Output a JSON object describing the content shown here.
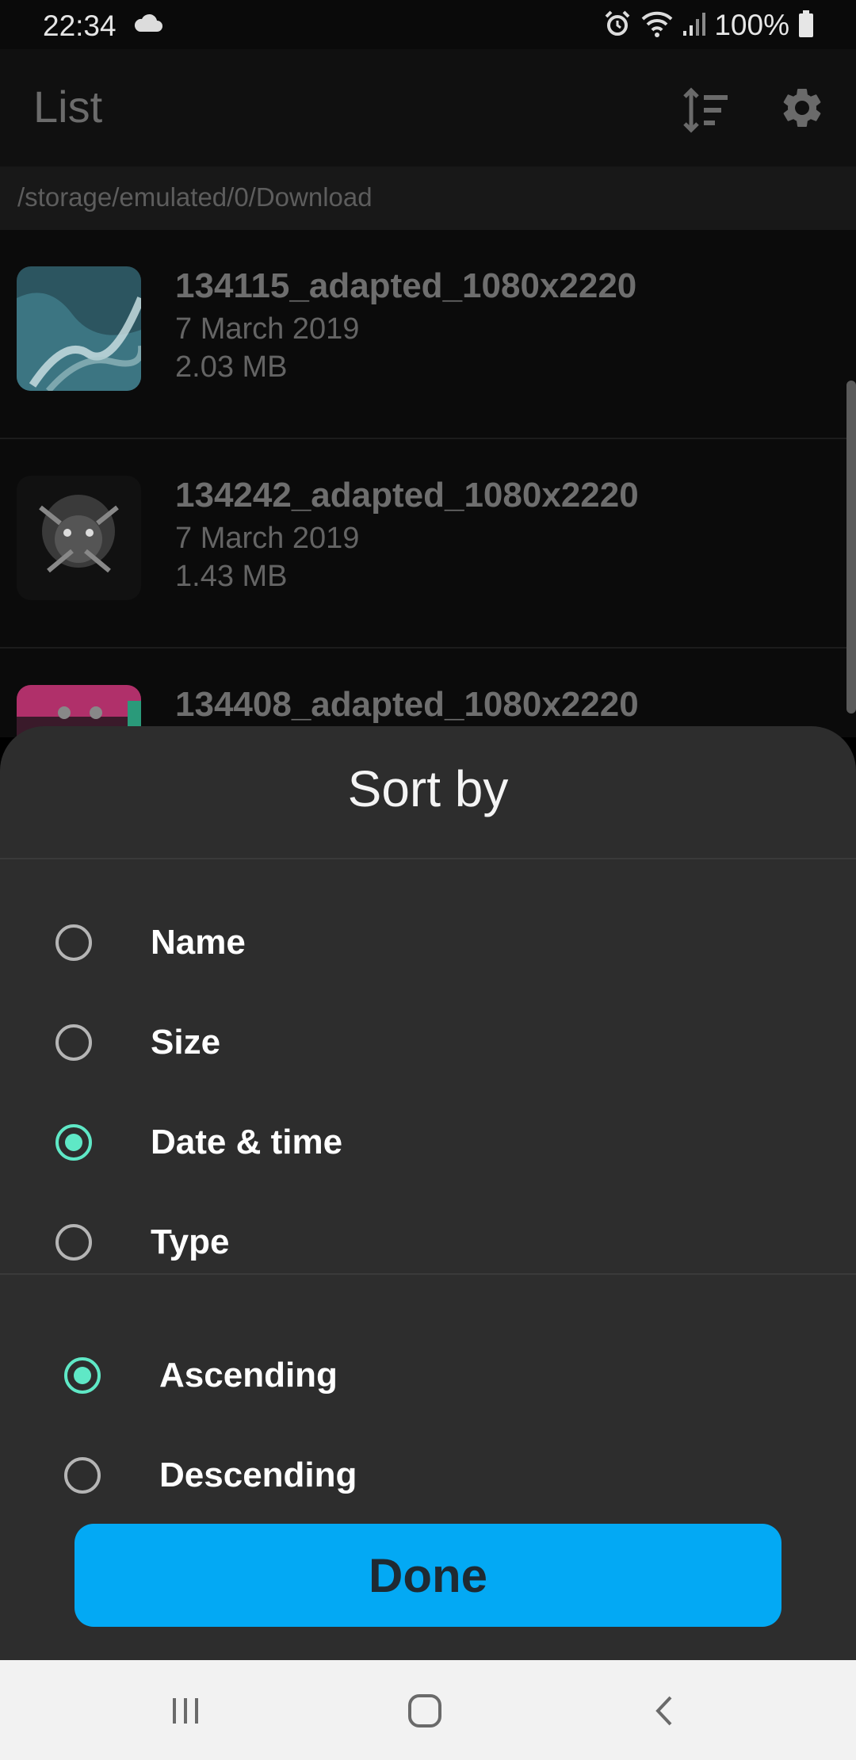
{
  "status_bar": {
    "time": "22:34",
    "battery": "100%",
    "icons": [
      "cloud-icon",
      "alarm-icon",
      "wifi-icon",
      "signal-icon",
      "battery-icon"
    ]
  },
  "app_bar": {
    "title": "List",
    "sort_icon": "sort-icon",
    "settings_icon": "gear-icon"
  },
  "path": "/storage/emulated/0/Download",
  "files": [
    {
      "name": "134115_adapted_1080x2220",
      "date": "7 March 2019",
      "size": "2.03 MB"
    },
    {
      "name": "134242_adapted_1080x2220",
      "date": "7 March 2019",
      "size": "1.43 MB"
    },
    {
      "name": "134408_adapted_1080x2220",
      "date": "",
      "size": ""
    }
  ],
  "sort_sheet": {
    "title": "Sort by",
    "sort_options": [
      {
        "label": "Name",
        "checked": false
      },
      {
        "label": "Size",
        "checked": false
      },
      {
        "label": "Date & time",
        "checked": true
      },
      {
        "label": "Type",
        "checked": false
      }
    ],
    "order_options": [
      {
        "label": "Ascending",
        "checked": true
      },
      {
        "label": "Descending",
        "checked": false
      }
    ],
    "done_label": "Done"
  },
  "colors": {
    "accent_radio": "#5fe8c6",
    "done_button": "#03a9f4",
    "sheet_background": "#2d2d2d"
  },
  "nav_bar": [
    "recents-icon",
    "home-icon",
    "back-icon"
  ]
}
